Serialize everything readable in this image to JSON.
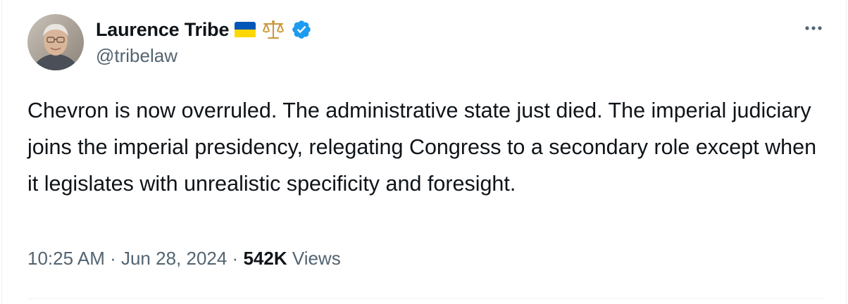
{
  "author": {
    "display_name": "Laurence Tribe",
    "handle": "@tribelaw",
    "badges": [
      "ukraine-flag-icon",
      "balance-scale-icon",
      "verified-badge-icon"
    ],
    "verified_color": "#1d9bf0"
  },
  "menu": {
    "icon": "more-horizontal-icon"
  },
  "tweet": {
    "text": "Chevron is now overruled. The administrative state just died. The imperial judiciary joins the imperial presidency, relegating Congress to a secondary role except when it legislates with unrealistic specificity and foresight."
  },
  "meta": {
    "time": "10:25 AM",
    "separator": " · ",
    "date": "Jun 28, 2024",
    "views_count": "542K",
    "views_label": " Views"
  },
  "colors": {
    "text_primary": "#0f1419",
    "text_secondary": "#536471",
    "border": "#eff3f4"
  }
}
